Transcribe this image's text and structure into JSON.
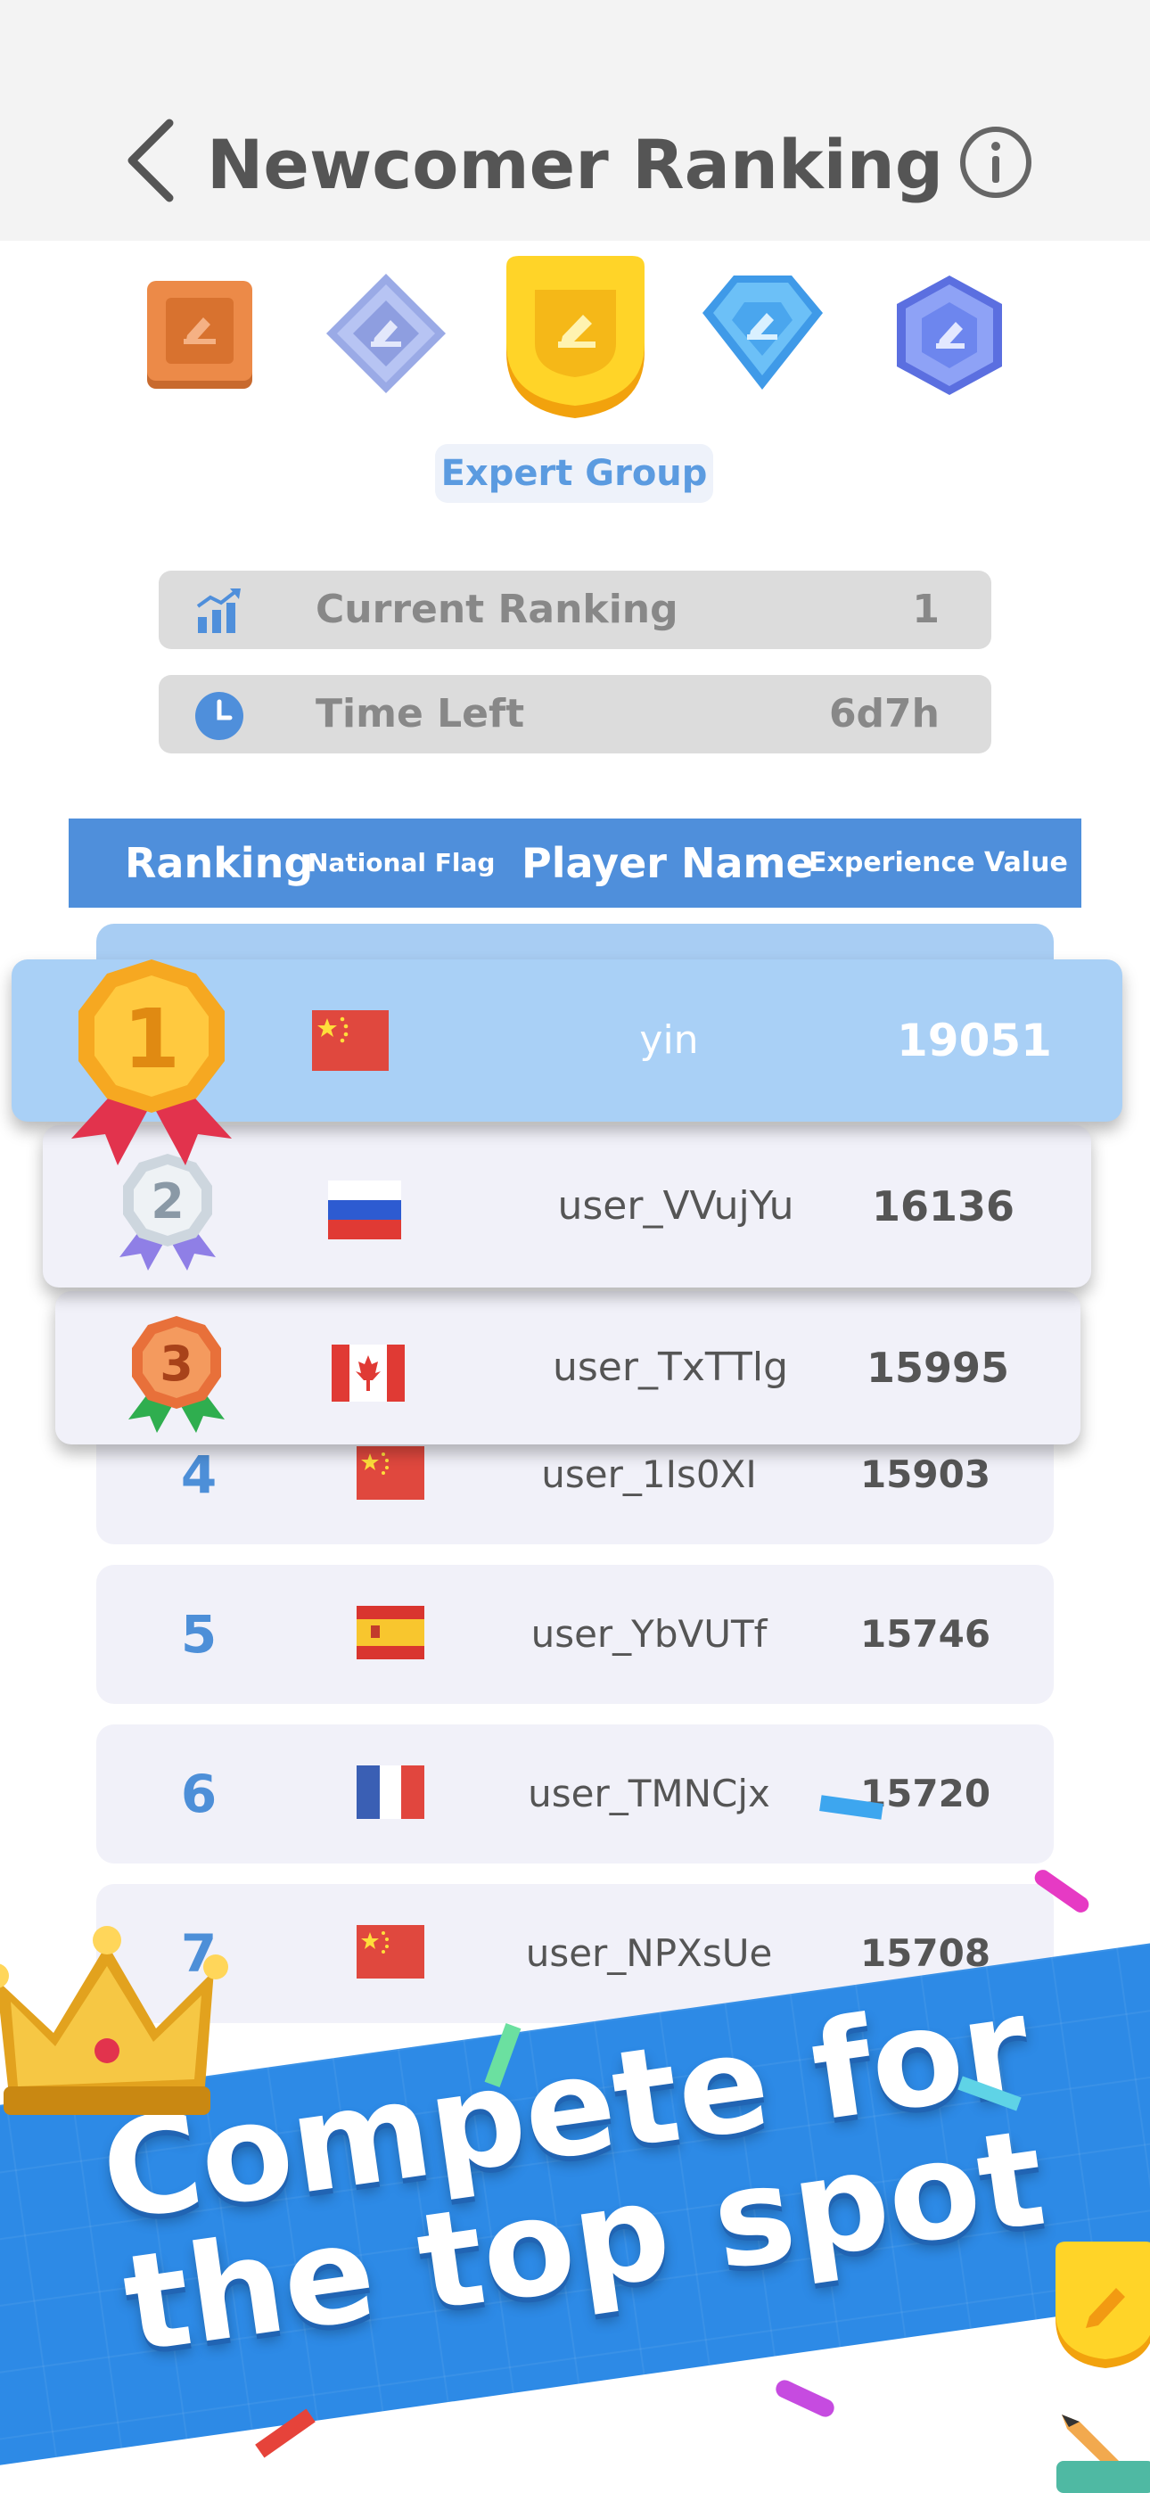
{
  "header": {
    "title": "Newcomer Ranking",
    "back_icon": "chevron-left-icon",
    "info_icon": "info-icon"
  },
  "tiers": [
    {
      "name": "tier-bronze",
      "color": "#e8874a"
    },
    {
      "name": "tier-silver",
      "color": "#aab8ef"
    },
    {
      "name": "tier-gold",
      "color": "#f7c21a",
      "selected": true
    },
    {
      "name": "tier-diamond",
      "color": "#5fb3f3"
    },
    {
      "name": "tier-master",
      "color": "#6d86ee"
    }
  ],
  "group_label": "Expert Group",
  "stats": {
    "current_ranking_label": "Current Ranking",
    "current_ranking_value": "1",
    "time_left_label": "Time Left",
    "time_left_value": "6d7h"
  },
  "table": {
    "headers": {
      "ranking": "Ranking",
      "flag": "National Flag",
      "name": "Player Name",
      "experience": "Experience Value"
    },
    "rows": [
      {
        "rank": "1",
        "country": "CN",
        "name": "yin",
        "exp": "19051"
      },
      {
        "rank": "2",
        "country": "RU",
        "name": "user_VVujYu",
        "exp": "16136"
      },
      {
        "rank": "3",
        "country": "CA",
        "name": "user_TxTTlg",
        "exp": "15995"
      },
      {
        "rank": "4",
        "country": "CN",
        "name": "user_1Is0XI",
        "exp": "15903"
      },
      {
        "rank": "5",
        "country": "ES",
        "name": "user_YbVUTf",
        "exp": "15746"
      },
      {
        "rank": "6",
        "country": "FR",
        "name": "user_TMNCjx",
        "exp": "15720"
      },
      {
        "rank": "7",
        "country": "CN",
        "name": "user_NPXsUe",
        "exp": "15708"
      }
    ]
  },
  "promo": {
    "line1": "Compete for",
    "line2": "the top spot"
  },
  "colors": {
    "accent": "#4f8fdb",
    "highlight": "#a9d0f6",
    "row_bg": "#f1f1f9",
    "banner": "#2d8ae6"
  }
}
